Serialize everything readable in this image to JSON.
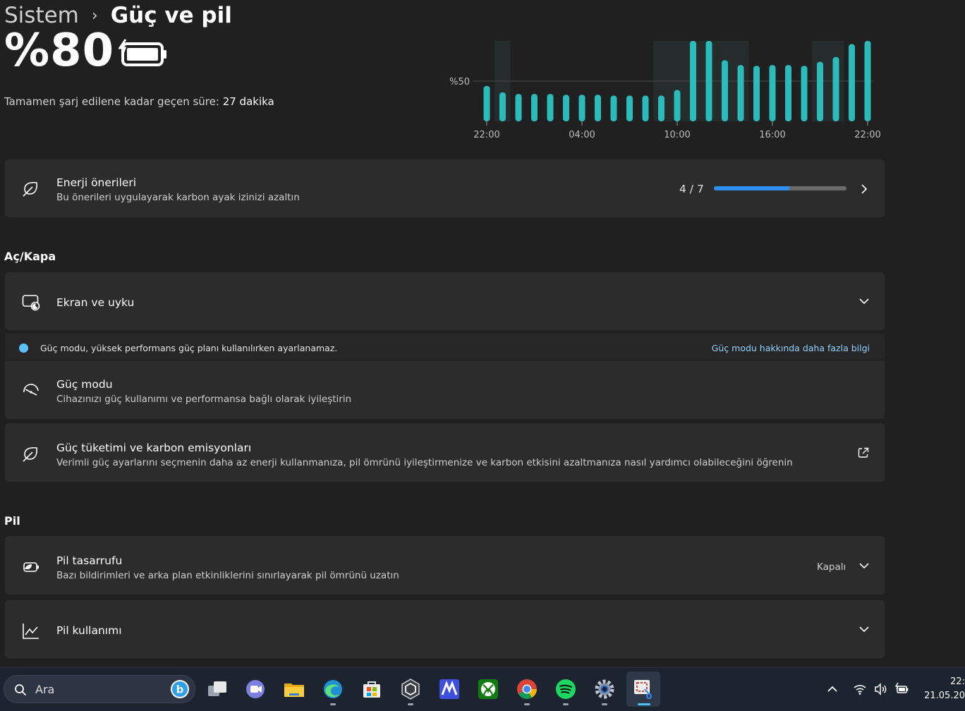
{
  "header": {
    "breadcrumb_parent": "Sistem",
    "breadcrumb_separator": "›",
    "page_title": "Güç ve pil"
  },
  "battery": {
    "percent": "%80",
    "charge_label": "Tamamen şarj edilene kadar geçen süre:",
    "charge_value": "27 dakika"
  },
  "chart_data": {
    "type": "bar",
    "y_reference_label": "%50",
    "x_tick_labels": [
      "22:00",
      "04:00",
      "10:00",
      "16:00",
      "22:00"
    ],
    "ylim": [
      0,
      100
    ],
    "values": [
      44,
      36,
      34,
      34,
      34,
      33,
      33,
      33,
      32,
      32,
      32,
      32,
      39,
      100,
      100,
      76,
      70,
      69,
      70,
      70,
      69,
      74,
      80,
      96,
      100
    ],
    "charging_shaded_bars": [
      1,
      11,
      12,
      13,
      14,
      15,
      16,
      21,
      22
    ],
    "bar_color": "#2bbbbb"
  },
  "energy_card": {
    "title": "Enerji önerileri",
    "description": "Bu önerileri uygulayarak karbon ayak izinizi azaltın",
    "progress_text": "4 / 7",
    "progress_fraction": 0.57
  },
  "section_onoff": "Aç/Kapa",
  "screen_sleep": {
    "title": "Ekran ve uyku"
  },
  "info_bar": {
    "text": "Güç modu, yüksek performans güç planı kullanılırken ayarlanamaz.",
    "link": "Güç modu hakkında daha fazla bilgi"
  },
  "power_mode": {
    "title": "Güç modu",
    "description": "Cihazınızı güç kullanımı ve performansa bağlı olarak iyileştirin"
  },
  "consumption": {
    "title": "Güç tüketimi ve karbon emisyonları",
    "description": "Verimli güç ayarlarını seçmenin daha az enerji kullanmanıza, pil ömrünü iyileştirmenize ve karbon etkisini azaltmanıza nasıl yardımcı olabileceğini öğrenin"
  },
  "section_battery": "Pil",
  "battery_saver": {
    "title": "Pil tasarrufu",
    "description": "Bazı bildirimleri ve arka plan etkinliklerini sınırlayarak pil ömrünü uzatın",
    "status": "Kapalı"
  },
  "battery_usage": {
    "title": "Pil kullanımı"
  },
  "taskbar": {
    "search_placeholder": "Ara",
    "clock_time": "22:",
    "clock_date": "21.05.20",
    "icons": [
      "task-view",
      "teams",
      "file-explorer",
      "edge",
      "microsoft-store",
      "unity",
      "mark-app",
      "xbox",
      "chrome",
      "spotify",
      "settings",
      "snipping-tool"
    ]
  },
  "colors": {
    "accent": "#2f8ff0",
    "card": "#2c2c2c",
    "background": "#202020",
    "link": "#8fd2ff",
    "bar": "#2bbbbb"
  }
}
